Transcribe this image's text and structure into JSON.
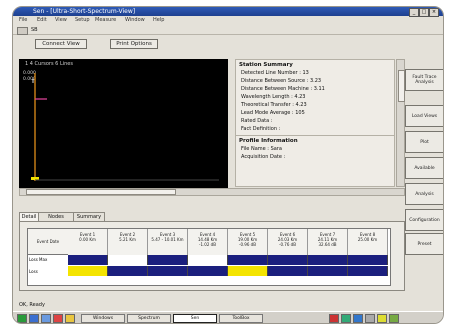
{
  "window": {
    "title": "Sen - [Ultra-Short-Spectrum-View]",
    "menu": [
      "File",
      "Edit",
      "View",
      "Setup",
      "Measure",
      "Window",
      "Help"
    ],
    "toolbar_label": "SB"
  },
  "buttons": {
    "left": "Connect View",
    "right": "Print Options"
  },
  "graph": {
    "header": "1 4 Cursors  6 Lines",
    "y_label_top": "0.000",
    "y_label_2": "0.000"
  },
  "summary": {
    "heading": "Station Summary",
    "lines": [
      "Detected Line Number : 13",
      "Distance Between Source : 3.23",
      "Distance Between Machine : 3.11",
      "Wavelength Length : 4.23",
      "Theoretical Transfer : 4.23",
      "Lead Mode Average : 105",
      "Rated Data :",
      "Fact Definition :"
    ],
    "heading2": "Profile Information",
    "lines2": [
      "File Name : Sara",
      "Acquisition Date :"
    ]
  },
  "right_buttons": [
    "Fault Trace Analysis",
    "Load Views",
    "Plot",
    "Available",
    "Analysis",
    "Configuration",
    "Preset"
  ],
  "tabs": [
    "Detail",
    "Nodes Control",
    "Summary"
  ],
  "table": {
    "row_header": "Event Date",
    "columns": [
      "Event 1\n0.00 Km",
      "Event 2\n5.21 Km",
      "Event 3\n5.47 - 10.01 Km",
      "Event 4\n14.48 Km\n-1.02 dB",
      "Event 5\n19.00 Km\n-0.96 dB",
      "Event 6\n24.03 Km\n-0.76 dB",
      "Event 7\n24.11 Km\n32.64 dB",
      "Event 8\n25.00 Km"
    ],
    "row_labels": [
      "Loss Max",
      "Loss"
    ]
  },
  "status": "OK, Ready",
  "taskbar": {
    "tasks": [
      "Windows",
      "Spectrum",
      "Sen",
      "ToolBox"
    ]
  },
  "colors": {
    "navy": "#1b1f7e",
    "yellow": "#f4e400",
    "trace_pink": "#e0449a",
    "trace_orange": "#f39a1c",
    "titlebar": "#2348a8"
  }
}
